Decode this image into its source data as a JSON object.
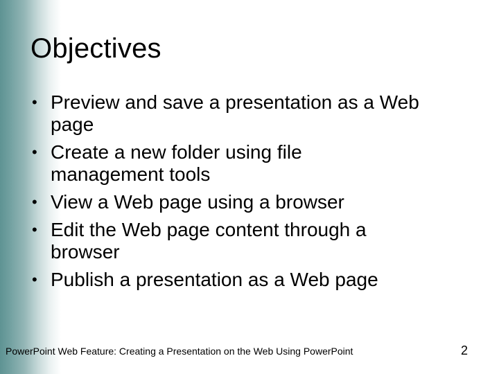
{
  "slide": {
    "title": "Objectives",
    "bullets": [
      {
        "symbol": "•",
        "lines": [
          "Preview and save a presentation as a Web",
          "page"
        ]
      },
      {
        "symbol": "•",
        "lines": [
          "Create a new folder using file",
          "management tools"
        ]
      },
      {
        "symbol": "•",
        "lines": [
          "View a Web page using a browser"
        ]
      },
      {
        "symbol": "•",
        "lines": [
          "Edit the Web page content through a",
          "browser"
        ]
      },
      {
        "symbol": "•",
        "lines": [
          "Publish a presentation as a Web page"
        ]
      }
    ],
    "footer": "PowerPoint Web Feature: Creating a Presentation on the Web Using PowerPoint",
    "page_number": "2"
  },
  "colors": {
    "accent_gradient_start": "#5e9393",
    "background": "#ffffff",
    "text": "#000000"
  }
}
